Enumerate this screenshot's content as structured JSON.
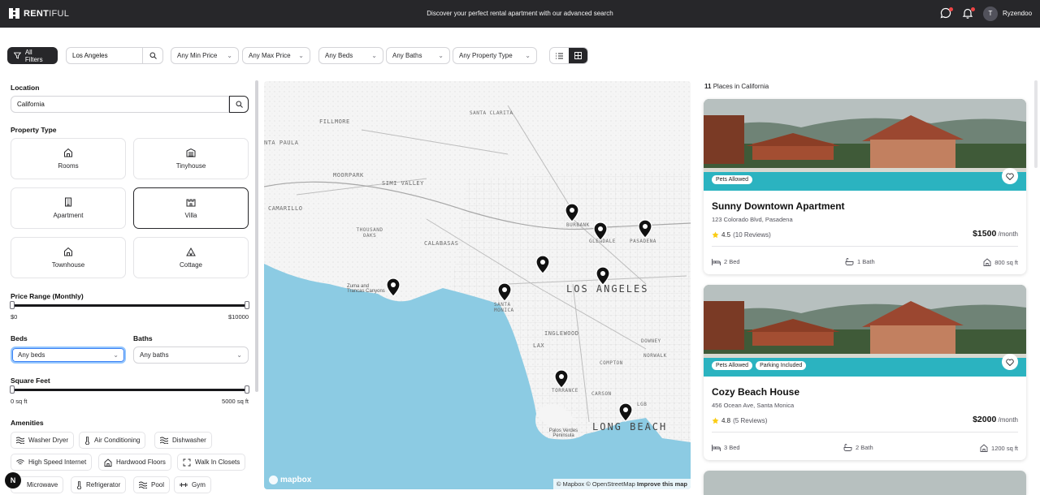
{
  "brand": {
    "bold": "RENT",
    "light": "IFUL"
  },
  "nav": {
    "tagline": "Discover your perfect rental apartment with our advanced search",
    "user_initial": "T",
    "user_name": "Ryzendoo"
  },
  "filters": {
    "all_filters": "All Filters",
    "location": "Los Angeles",
    "min_price": "Any Min Price",
    "max_price": "Any Max Price",
    "beds": "Any Beds",
    "baths": "Any Baths",
    "property_type": "Any Property Type"
  },
  "sidebar": {
    "location_label": "Location",
    "location_value": "California",
    "property_type_label": "Property Type",
    "types": [
      {
        "label": "Rooms",
        "icon": "home-icon"
      },
      {
        "label": "Tinyhouse",
        "icon": "warehouse-icon"
      },
      {
        "label": "Apartment",
        "icon": "building-icon"
      },
      {
        "label": "Villa",
        "icon": "castle-icon"
      },
      {
        "label": "Townhouse",
        "icon": "home-icon"
      },
      {
        "label": "Cottage",
        "icon": "tent-icon"
      }
    ],
    "selected_type": "Villa",
    "price_label": "Price Range (Monthly)",
    "price_min": "$0",
    "price_max": "$10000",
    "beds_label": "Beds",
    "beds_value": "Any beds",
    "baths_label": "Baths",
    "baths_value": "Any baths",
    "sqft_label": "Square Feet",
    "sqft_min": "0 sq ft",
    "sqft_max": "5000 sq ft",
    "amenities_label": "Amenities",
    "amenities": [
      "Washer Dryer",
      "Air Conditioning",
      "Dishwasher",
      "High Speed Internet",
      "Hardwood Floors",
      "Walk In Closets",
      "Microwave",
      "Refrigerator",
      "Pool",
      "Gym"
    ]
  },
  "map": {
    "labels": [
      "FILLMORE",
      "SANTA CLARITA",
      "NTA PAULA",
      "MOORPARK",
      "SIMI VALLEY",
      "CAMARILLO",
      "THOUSAND OAKS",
      "CALABASAS",
      "BURBANK",
      "GLENDALE",
      "PASADENA",
      "LOS ANGELES",
      "Zuma and Trancas Canyons",
      "SANTA MONICA",
      "INGLEWOOD",
      "DOWNEY",
      "LAX",
      "NORWALK",
      "COMPTON",
      "TORRANCE",
      "CARSON",
      "LGB",
      "LONG BEACH",
      "Palos Verdes Peninsula"
    ],
    "logo": "mapbox",
    "attribution": "© Mapbox © OpenStreetMap",
    "improve": "Improve this map"
  },
  "results": {
    "count": "11",
    "suffix": "Places in California"
  },
  "listings": [
    {
      "title": "Sunny Downtown Apartment",
      "address": "123 Colorado Blvd, Pasadena",
      "rating": "4.5",
      "reviews": "(10 Reviews)",
      "price": "$1500",
      "per": "/month",
      "beds": "2 Bed",
      "baths": "1 Bath",
      "sqft": "800 sq ft",
      "tags": [
        "Pets Allowed"
      ]
    },
    {
      "title": "Cozy Beach House",
      "address": "456 Ocean Ave, Santa Monica",
      "rating": "4.8",
      "reviews": "(5 Reviews)",
      "price": "$2000",
      "per": "/month",
      "beds": "3 Bed",
      "baths": "2 Bath",
      "sqft": "1200 sq ft",
      "tags": [
        "Pets Allowed",
        "Parking Included"
      ]
    }
  ],
  "misc": {
    "badge": "N"
  }
}
